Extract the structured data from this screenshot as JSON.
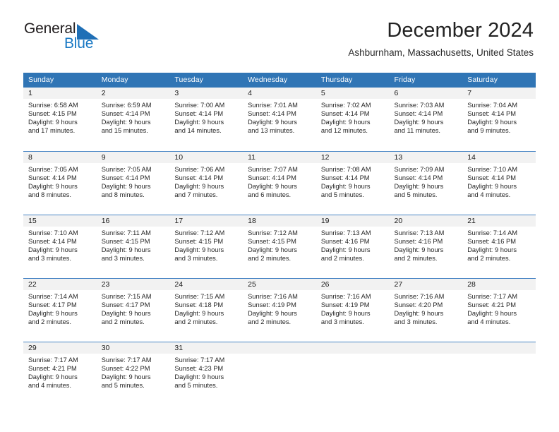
{
  "brand": {
    "name_part1": "General",
    "name_part2": "Blue",
    "triangle_color": "#1f6fb6",
    "blue_text_color": "#1878c4"
  },
  "header": {
    "month_title": "December 2024",
    "location": "Ashburnham, Massachusetts, United States"
  },
  "theme": {
    "header_blue": "#3075b5",
    "daynum_band": "#f2f2f2",
    "row_border": "#4a86c5"
  },
  "calendar": {
    "weekday_headers": [
      "Sunday",
      "Monday",
      "Tuesday",
      "Wednesday",
      "Thursday",
      "Friday",
      "Saturday"
    ],
    "weeks": [
      [
        {
          "day": "1",
          "sunrise": "Sunrise: 6:58 AM",
          "sunset": "Sunset: 4:15 PM",
          "daylight_1": "Daylight: 9 hours",
          "daylight_2": "and 17 minutes."
        },
        {
          "day": "2",
          "sunrise": "Sunrise: 6:59 AM",
          "sunset": "Sunset: 4:14 PM",
          "daylight_1": "Daylight: 9 hours",
          "daylight_2": "and 15 minutes."
        },
        {
          "day": "3",
          "sunrise": "Sunrise: 7:00 AM",
          "sunset": "Sunset: 4:14 PM",
          "daylight_1": "Daylight: 9 hours",
          "daylight_2": "and 14 minutes."
        },
        {
          "day": "4",
          "sunrise": "Sunrise: 7:01 AM",
          "sunset": "Sunset: 4:14 PM",
          "daylight_1": "Daylight: 9 hours",
          "daylight_2": "and 13 minutes."
        },
        {
          "day": "5",
          "sunrise": "Sunrise: 7:02 AM",
          "sunset": "Sunset: 4:14 PM",
          "daylight_1": "Daylight: 9 hours",
          "daylight_2": "and 12 minutes."
        },
        {
          "day": "6",
          "sunrise": "Sunrise: 7:03 AM",
          "sunset": "Sunset: 4:14 PM",
          "daylight_1": "Daylight: 9 hours",
          "daylight_2": "and 11 minutes."
        },
        {
          "day": "7",
          "sunrise": "Sunrise: 7:04 AM",
          "sunset": "Sunset: 4:14 PM",
          "daylight_1": "Daylight: 9 hours",
          "daylight_2": "and 9 minutes."
        }
      ],
      [
        {
          "day": "8",
          "sunrise": "Sunrise: 7:05 AM",
          "sunset": "Sunset: 4:14 PM",
          "daylight_1": "Daylight: 9 hours",
          "daylight_2": "and 8 minutes."
        },
        {
          "day": "9",
          "sunrise": "Sunrise: 7:05 AM",
          "sunset": "Sunset: 4:14 PM",
          "daylight_1": "Daylight: 9 hours",
          "daylight_2": "and 8 minutes."
        },
        {
          "day": "10",
          "sunrise": "Sunrise: 7:06 AM",
          "sunset": "Sunset: 4:14 PM",
          "daylight_1": "Daylight: 9 hours",
          "daylight_2": "and 7 minutes."
        },
        {
          "day": "11",
          "sunrise": "Sunrise: 7:07 AM",
          "sunset": "Sunset: 4:14 PM",
          "daylight_1": "Daylight: 9 hours",
          "daylight_2": "and 6 minutes."
        },
        {
          "day": "12",
          "sunrise": "Sunrise: 7:08 AM",
          "sunset": "Sunset: 4:14 PM",
          "daylight_1": "Daylight: 9 hours",
          "daylight_2": "and 5 minutes."
        },
        {
          "day": "13",
          "sunrise": "Sunrise: 7:09 AM",
          "sunset": "Sunset: 4:14 PM",
          "daylight_1": "Daylight: 9 hours",
          "daylight_2": "and 5 minutes."
        },
        {
          "day": "14",
          "sunrise": "Sunrise: 7:10 AM",
          "sunset": "Sunset: 4:14 PM",
          "daylight_1": "Daylight: 9 hours",
          "daylight_2": "and 4 minutes."
        }
      ],
      [
        {
          "day": "15",
          "sunrise": "Sunrise: 7:10 AM",
          "sunset": "Sunset: 4:14 PM",
          "daylight_1": "Daylight: 9 hours",
          "daylight_2": "and 3 minutes."
        },
        {
          "day": "16",
          "sunrise": "Sunrise: 7:11 AM",
          "sunset": "Sunset: 4:15 PM",
          "daylight_1": "Daylight: 9 hours",
          "daylight_2": "and 3 minutes."
        },
        {
          "day": "17",
          "sunrise": "Sunrise: 7:12 AM",
          "sunset": "Sunset: 4:15 PM",
          "daylight_1": "Daylight: 9 hours",
          "daylight_2": "and 3 minutes."
        },
        {
          "day": "18",
          "sunrise": "Sunrise: 7:12 AM",
          "sunset": "Sunset: 4:15 PM",
          "daylight_1": "Daylight: 9 hours",
          "daylight_2": "and 2 minutes."
        },
        {
          "day": "19",
          "sunrise": "Sunrise: 7:13 AM",
          "sunset": "Sunset: 4:16 PM",
          "daylight_1": "Daylight: 9 hours",
          "daylight_2": "and 2 minutes."
        },
        {
          "day": "20",
          "sunrise": "Sunrise: 7:13 AM",
          "sunset": "Sunset: 4:16 PM",
          "daylight_1": "Daylight: 9 hours",
          "daylight_2": "and 2 minutes."
        },
        {
          "day": "21",
          "sunrise": "Sunrise: 7:14 AM",
          "sunset": "Sunset: 4:16 PM",
          "daylight_1": "Daylight: 9 hours",
          "daylight_2": "and 2 minutes."
        }
      ],
      [
        {
          "day": "22",
          "sunrise": "Sunrise: 7:14 AM",
          "sunset": "Sunset: 4:17 PM",
          "daylight_1": "Daylight: 9 hours",
          "daylight_2": "and 2 minutes."
        },
        {
          "day": "23",
          "sunrise": "Sunrise: 7:15 AM",
          "sunset": "Sunset: 4:17 PM",
          "daylight_1": "Daylight: 9 hours",
          "daylight_2": "and 2 minutes."
        },
        {
          "day": "24",
          "sunrise": "Sunrise: 7:15 AM",
          "sunset": "Sunset: 4:18 PM",
          "daylight_1": "Daylight: 9 hours",
          "daylight_2": "and 2 minutes."
        },
        {
          "day": "25",
          "sunrise": "Sunrise: 7:16 AM",
          "sunset": "Sunset: 4:19 PM",
          "daylight_1": "Daylight: 9 hours",
          "daylight_2": "and 2 minutes."
        },
        {
          "day": "26",
          "sunrise": "Sunrise: 7:16 AM",
          "sunset": "Sunset: 4:19 PM",
          "daylight_1": "Daylight: 9 hours",
          "daylight_2": "and 3 minutes."
        },
        {
          "day": "27",
          "sunrise": "Sunrise: 7:16 AM",
          "sunset": "Sunset: 4:20 PM",
          "daylight_1": "Daylight: 9 hours",
          "daylight_2": "and 3 minutes."
        },
        {
          "day": "28",
          "sunrise": "Sunrise: 7:17 AM",
          "sunset": "Sunset: 4:21 PM",
          "daylight_1": "Daylight: 9 hours",
          "daylight_2": "and 4 minutes."
        }
      ],
      [
        {
          "day": "29",
          "sunrise": "Sunrise: 7:17 AM",
          "sunset": "Sunset: 4:21 PM",
          "daylight_1": "Daylight: 9 hours",
          "daylight_2": "and 4 minutes."
        },
        {
          "day": "30",
          "sunrise": "Sunrise: 7:17 AM",
          "sunset": "Sunset: 4:22 PM",
          "daylight_1": "Daylight: 9 hours",
          "daylight_2": "and 5 minutes."
        },
        {
          "day": "31",
          "sunrise": "Sunrise: 7:17 AM",
          "sunset": "Sunset: 4:23 PM",
          "daylight_1": "Daylight: 9 hours",
          "daylight_2": "and 5 minutes."
        },
        {
          "day": "",
          "sunrise": "",
          "sunset": "",
          "daylight_1": "",
          "daylight_2": ""
        },
        {
          "day": "",
          "sunrise": "",
          "sunset": "",
          "daylight_1": "",
          "daylight_2": ""
        },
        {
          "day": "",
          "sunrise": "",
          "sunset": "",
          "daylight_1": "",
          "daylight_2": ""
        },
        {
          "day": "",
          "sunrise": "",
          "sunset": "",
          "daylight_1": "",
          "daylight_2": ""
        }
      ]
    ]
  }
}
